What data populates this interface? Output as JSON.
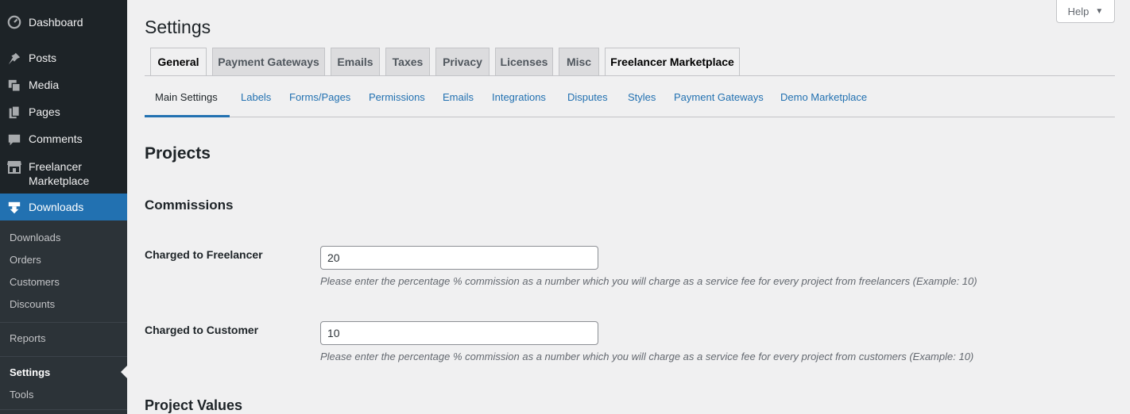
{
  "sidebar": {
    "items": [
      {
        "label": "Dashboard",
        "icon": "dashboard-icon"
      },
      {
        "label": "Posts",
        "icon": "pin-icon"
      },
      {
        "label": "Media",
        "icon": "media-icon"
      },
      {
        "label": "Pages",
        "icon": "pages-icon"
      },
      {
        "label": "Comments",
        "icon": "comment-icon"
      },
      {
        "label": "Freelancer Marketplace",
        "icon": "store-icon"
      },
      {
        "label": "Downloads",
        "icon": "download-icon"
      }
    ],
    "submenu": [
      "Downloads",
      "Orders",
      "Customers",
      "Discounts",
      "Reports",
      "Settings",
      "Tools"
    ],
    "active_submenu": "Settings"
  },
  "help": {
    "label": "Help",
    "arrow": "▼"
  },
  "page": {
    "title": "Settings"
  },
  "tabs": [
    "General",
    "Payment Gateways",
    "Emails",
    "Taxes",
    "Privacy",
    "Licenses",
    "Misc",
    "Freelancer Marketplace"
  ],
  "subtabs": [
    "Main Settings",
    "Labels",
    "Forms/Pages",
    "Permissions",
    "Emails",
    "Integrations",
    "Disputes",
    "Styles",
    "Payment Gateways",
    "Demo Marketplace"
  ],
  "content": {
    "section_title": "Projects",
    "commissions_heading": "Commissions",
    "freelancer_label": "Charged to Freelancer",
    "freelancer_value": "20",
    "freelancer_desc": "Please enter the percentage % commission as a number which you will charge as a service fee for every project from freelancers (Example: 10)",
    "customer_label": "Charged to Customer",
    "customer_value": "10",
    "customer_desc": "Please enter the percentage % commission as a number which you will charge as a service fee for every project from customers (Example: 10)",
    "values_heading": "Project Values"
  },
  "colors": {
    "sidebar_bg": "#1d2327",
    "accent": "#2271b1",
    "page_bg": "#f0f0f1"
  }
}
